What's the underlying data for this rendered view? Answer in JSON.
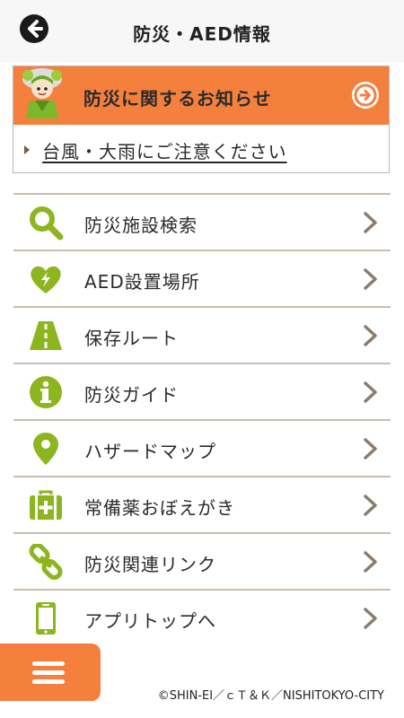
{
  "header": {
    "title": "防災・AED情報",
    "back_icon": "arrow-left-circle-icon"
  },
  "notice": {
    "title": "防災に関するお知らせ",
    "mascot": "mascot-icon",
    "go_icon": "arrow-right-circle-icon",
    "items": [
      "台風・大雨にご注意ください"
    ]
  },
  "menu": {
    "items": [
      {
        "label": "防災施設検索",
        "icon": "search-icon"
      },
      {
        "label": "AED設置場所",
        "icon": "aed-heart-icon"
      },
      {
        "label": "保存ルート",
        "icon": "road-icon"
      },
      {
        "label": "防災ガイド",
        "icon": "info-icon"
      },
      {
        "label": "ハザードマップ",
        "icon": "map-pin-icon"
      },
      {
        "label": "常備薬おぼえがき",
        "icon": "first-aid-kit-icon"
      },
      {
        "label": "防災関連リンク",
        "icon": "link-icon"
      },
      {
        "label": "アプリトップへ",
        "icon": "smartphone-icon"
      }
    ]
  },
  "footer": {
    "copyright": "©SHIN-EI／ｃＴ＆Ｋ／NISHITOKYO-CITY",
    "menu_icon": "hamburger-menu-icon"
  },
  "colors": {
    "accent_orange": "#f5803e",
    "icon_green": "#8cb51f",
    "chevron_brown": "#8c7b6a",
    "divider": "#c9bdb0"
  }
}
